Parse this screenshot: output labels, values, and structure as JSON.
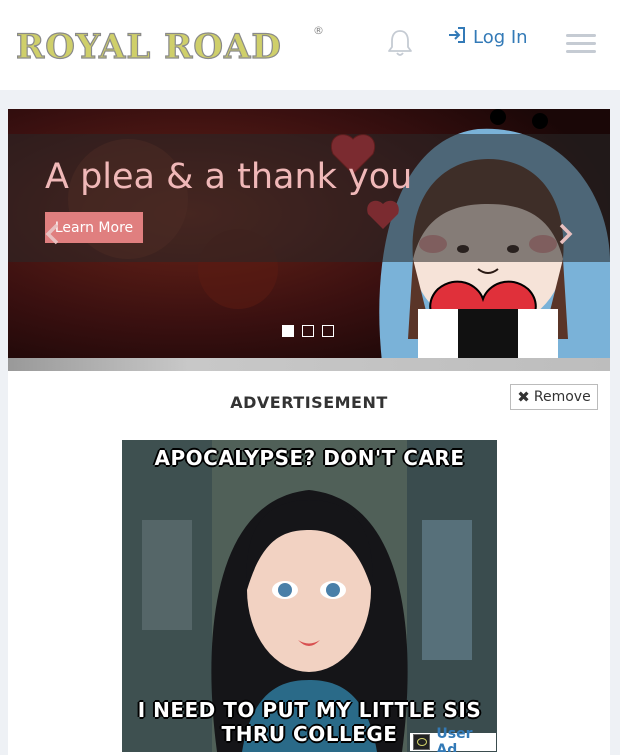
{
  "header": {
    "logo_text": "ROYAL ROAD",
    "logo_registered": "®",
    "login_label": "Log In",
    "icons": {
      "notifications": "bell-icon",
      "login": "sign-in-icon",
      "menu": "hamburger-icon"
    }
  },
  "carousel": {
    "title": "A plea & a thank you",
    "button_label": "Learn More",
    "slide_count": 3,
    "active_slide": 1,
    "icons": {
      "prev": "chevron-left-icon",
      "next": "chevron-right-icon"
    }
  },
  "ad": {
    "label": "ADVERTISEMENT",
    "remove_label": "Remove",
    "image_top_text": "APOCALYPSE? DON'T CARE",
    "image_bottom_line1": "I NEED TO PUT MY LITTLE SIS",
    "image_bottom_line2": "THRU COLLEGE",
    "user_ad_label": "User Ad"
  },
  "colors": {
    "brand_link": "#337ab7",
    "carousel_button": "#e07f7f",
    "carousel_title": "#f0b8b8"
  }
}
